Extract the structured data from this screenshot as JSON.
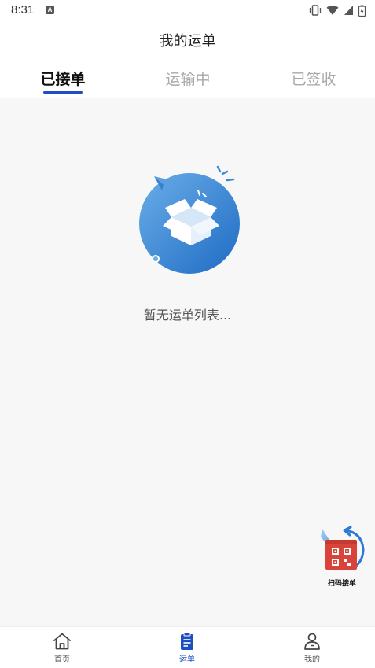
{
  "status_bar": {
    "time": "8:31",
    "indicator": "A"
  },
  "header": {
    "title": "我的运单"
  },
  "tabs": [
    {
      "label": "已接单",
      "active": true
    },
    {
      "label": "运输中",
      "active": false
    },
    {
      "label": "已签收",
      "active": false
    }
  ],
  "empty_state": {
    "message": "暂无运单列表...",
    "icon": "empty-box-icon"
  },
  "scan_fab": {
    "label": "扫码接单",
    "icon": "qr-code-icon"
  },
  "bottom_nav": [
    {
      "label": "首页",
      "icon": "home-icon",
      "active": false
    },
    {
      "label": "运单",
      "icon": "clipboard-icon",
      "active": true
    },
    {
      "label": "我的",
      "icon": "user-icon",
      "active": false
    }
  ],
  "colors": {
    "accent": "#1e4fc2",
    "background": "#f7f7f7",
    "inactive_tab": "#a8a8a8"
  }
}
